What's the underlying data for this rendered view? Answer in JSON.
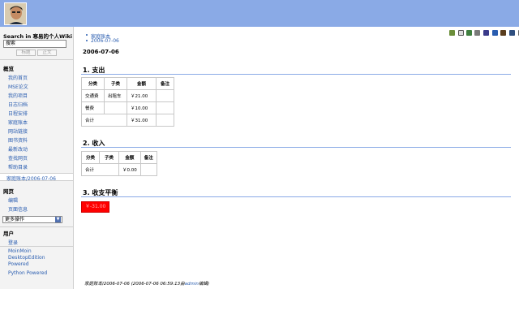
{
  "sidebar": {
    "search_heading": "Search in 寒易的个人Wiki",
    "search_value": "搜索",
    "title_button": "标题",
    "text_button": "正文",
    "nav_heading": "概览",
    "nav_items": [
      "我的首页",
      "MSE论文",
      "我的项目",
      "日志归档",
      "日程安排",
      "家庭账本",
      "网站链接",
      "图书资料",
      "最新改动",
      "查找网页",
      "帮助目录"
    ],
    "current_item": "家庭账本/2006-07-06",
    "page_heading": "网页",
    "page_items": [
      "编辑",
      "页面信息"
    ],
    "more_actions": "更多操作",
    "user_heading": "用户",
    "user_items": [
      "登录"
    ],
    "footer_links": [
      "MoinMoin",
      "DesktopEdition",
      "Powered",
      "Python Powered"
    ]
  },
  "breadcrumb": [
    "家庭账本",
    "2006-07-06"
  ],
  "page_heading": "2006-07-06",
  "sections": {
    "expense": {
      "title": "1. 支出",
      "headers": [
        "分类",
        "子类",
        "金额",
        "备注"
      ],
      "rows": [
        [
          "交通费",
          "出租车",
          "￥21.00",
          ""
        ],
        [
          "餐费",
          "",
          "￥10.00",
          ""
        ]
      ],
      "total_label": "合计",
      "total_value": "￥31.00"
    },
    "income": {
      "title": "2. 收入",
      "headers": [
        "分类",
        "子类",
        "金额",
        "备注"
      ],
      "total_label": "合计",
      "total_value": "￥0.00"
    },
    "balance": {
      "title": "3. 收支平衡",
      "value": "￥-31.00"
    }
  },
  "footer": {
    "page_name": "家庭账本/2006-07-06",
    "timestamp": "(2006-07-06 06:59:13由",
    "author": "admin",
    "suffix": "编辑)"
  },
  "icons": [
    "up-icon",
    "subscribe-icon",
    "raw-icon",
    "print-icon",
    "view-icon",
    "info-icon",
    "attach-icon",
    "edit-icon",
    "delete-icon"
  ],
  "colors": {
    "header_bg": "#8aaae6",
    "link": "#2a5db0",
    "balance_bg": "#ff0000"
  }
}
